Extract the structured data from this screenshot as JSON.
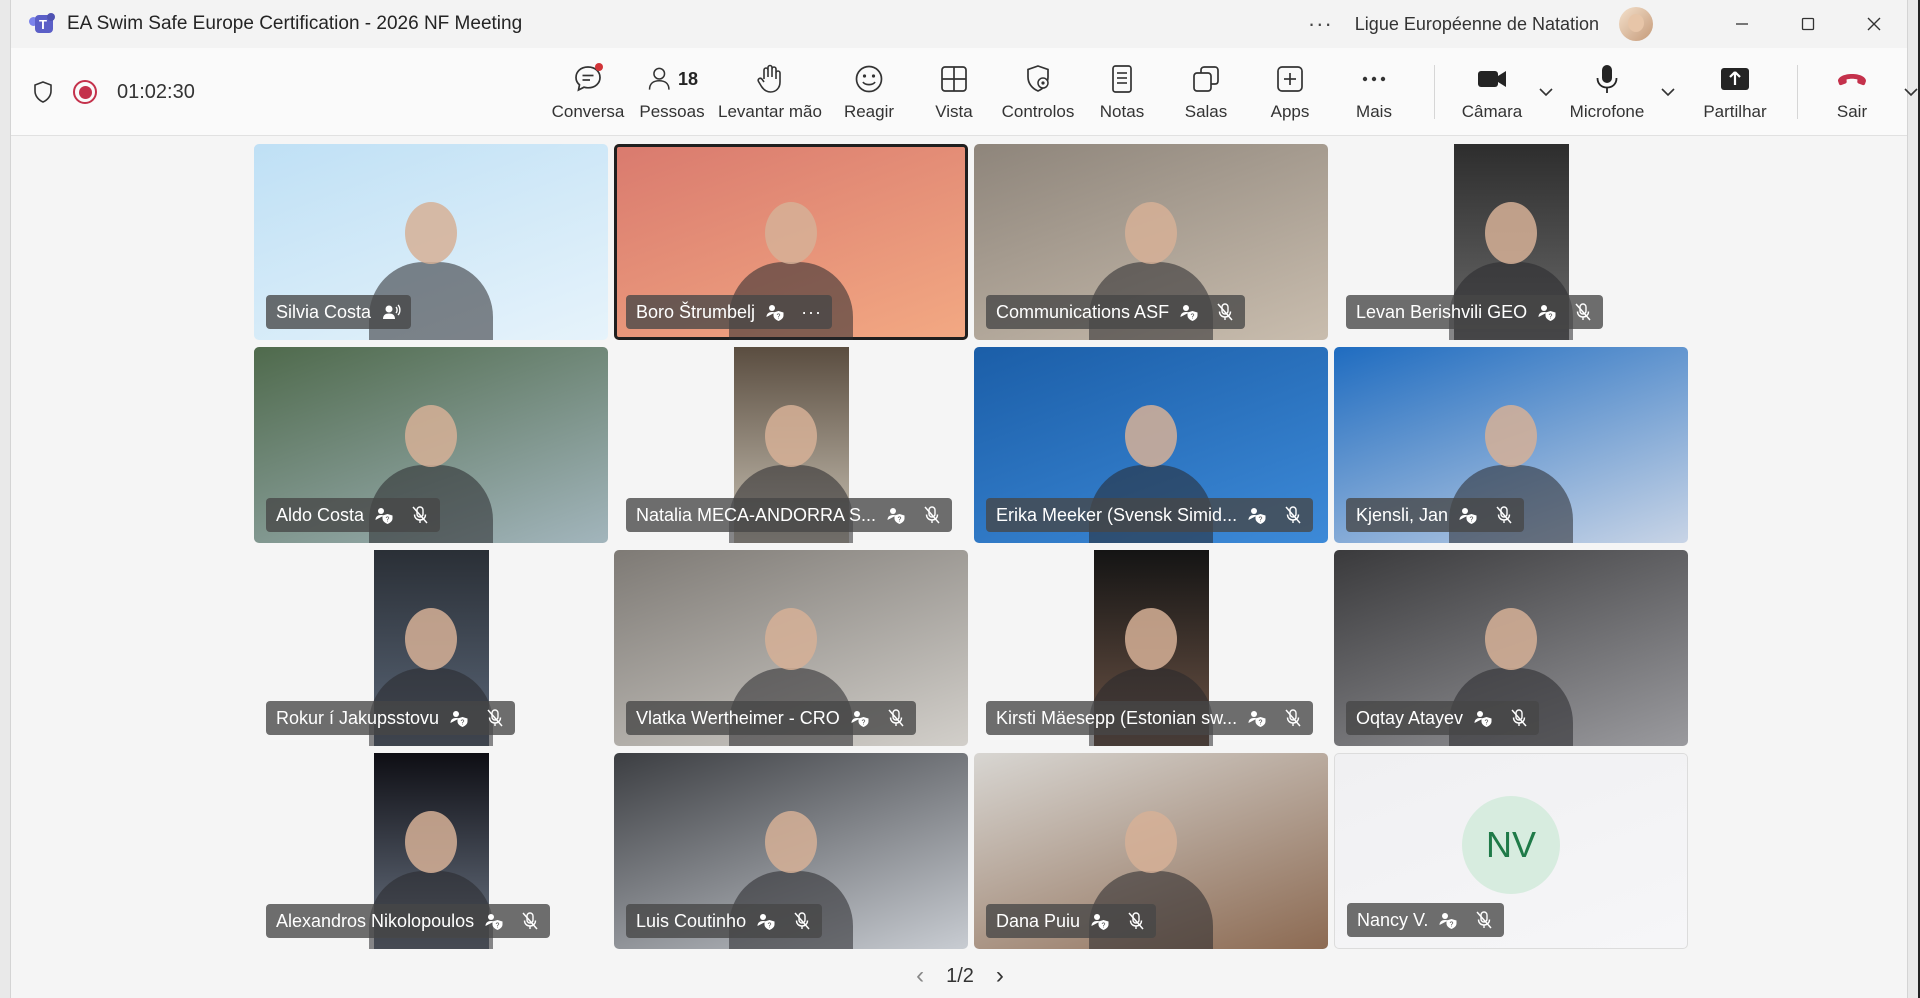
{
  "window": {
    "title": "EA Swim Safe Europe Certification - 2026 NF Meeting",
    "organization": "Ligue Européenne de Natation",
    "more": "···"
  },
  "meeting": {
    "timer": "01:02:30"
  },
  "toolbar": {
    "chat": "Conversa",
    "people": "Pessoas",
    "people_count": "18",
    "raise_hand": "Levantar mão",
    "react": "Reagir",
    "view": "Vista",
    "controls": "Controlos",
    "notes": "Notas",
    "rooms": "Salas",
    "apps": "Apps",
    "more": "Mais",
    "camera": "Câmara",
    "microphone": "Microfone",
    "share": "Partilhar",
    "leave": "Sair"
  },
  "participants": [
    {
      "name": "Silvia Costa",
      "status": "speaking",
      "bg": "#bfe0f5",
      "bg2": "#e6f3fb"
    },
    {
      "name": "Boro Štrumbelj",
      "status": "more",
      "bg": "#d97a6e",
      "bg2": "#f3a983"
    },
    {
      "name": "Communications ASF",
      "status": "muted",
      "bg": "#8e857b",
      "bg2": "#c9bdae"
    },
    {
      "name": "Levan Berishvili GEO",
      "status": "muted",
      "bg": "#2d2d2d",
      "bg2": "#6a6a6a"
    },
    {
      "name": "Aldo Costa",
      "status": "muted",
      "bg": "#4f6a4c",
      "bg2": "#a2b5bc"
    },
    {
      "name": "Natalia MECA-ANDORRA S...",
      "status": "muted",
      "bg": "#5a4d40",
      "bg2": "#c9c2b4"
    },
    {
      "name": "Erika Meeker (Svensk Simid...",
      "status": "muted",
      "bg": "#1b5ea8",
      "bg2": "#3d8ad8"
    },
    {
      "name": "Kjensli, Jan",
      "status": "muted",
      "bg": "#1f6cc0",
      "bg2": "#c8d4e6"
    },
    {
      "name": "Rokur í Jakupsstovu",
      "status": "muted",
      "bg": "#2a2f36",
      "bg2": "#5a6677"
    },
    {
      "name": "Vlatka Wertheimer - CRO",
      "status": "muted",
      "bg": "#7e7a75",
      "bg2": "#d2cfca"
    },
    {
      "name": "Kirsti Mäesepp (Estonian sw...",
      "status": "muted",
      "bg": "#141414",
      "bg2": "#6d5446"
    },
    {
      "name": "Oqtay Atayev",
      "status": "muted",
      "bg": "#3a3a3c",
      "bg2": "#9a9a9e"
    },
    {
      "name": "Alexandros Nikolopoulos",
      "status": "muted",
      "bg": "#0e0e14",
      "bg2": "#6b7584"
    },
    {
      "name": "Luis Coutinho",
      "status": "muted",
      "bg": "#3c3e42",
      "bg2": "#c8ccd2"
    },
    {
      "name": "Dana Puiu",
      "status": "muted",
      "bg": "#d8d6d2",
      "bg2": "#8c6a52"
    },
    {
      "name": "Nancy V.",
      "status": "muted",
      "initials": "NV",
      "bg": "#f0f0f2",
      "bg2": "#f6f6f8"
    }
  ],
  "pager": {
    "label": "1/2"
  }
}
